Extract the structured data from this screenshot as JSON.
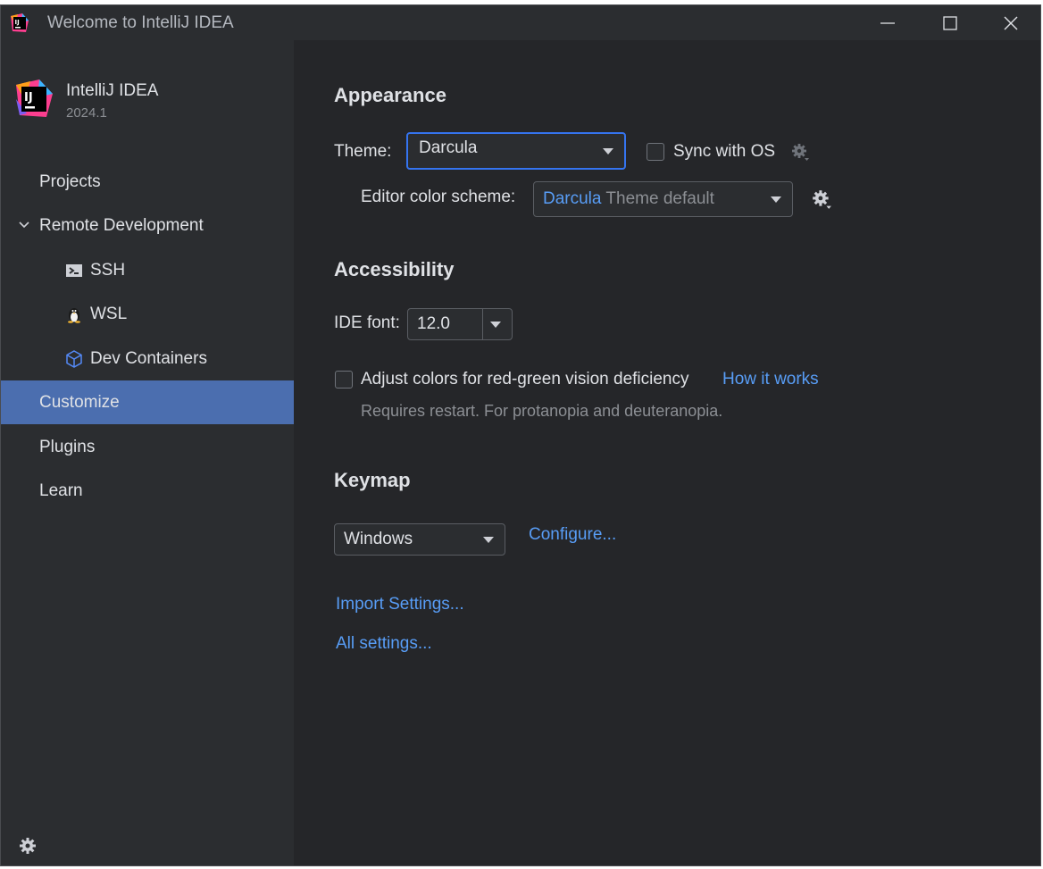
{
  "window": {
    "title": "Welcome to IntelliJ IDEA"
  },
  "brand": {
    "name": "IntelliJ IDEA",
    "version": "2024.1"
  },
  "sidebar": {
    "items": [
      {
        "label": "Projects"
      },
      {
        "label": "Remote Development"
      },
      {
        "label": "SSH"
      },
      {
        "label": "WSL"
      },
      {
        "label": "Dev Containers"
      },
      {
        "label": "Customize"
      },
      {
        "label": "Plugins"
      },
      {
        "label": "Learn"
      }
    ],
    "selected": "Customize"
  },
  "appearance": {
    "title": "Appearance",
    "theme_label": "Theme:",
    "theme_value": "Darcula",
    "sync_label": "Sync with OS",
    "editor_scheme_label": "Editor color scheme:",
    "editor_scheme_name": "Darcula",
    "editor_scheme_suffix": "Theme default"
  },
  "accessibility": {
    "title": "Accessibility",
    "ide_font_label": "IDE font:",
    "ide_font_value": "12.0",
    "adjust_colors_label": "Adjust colors for red-green vision deficiency",
    "how_it_works": "How it works",
    "hint": "Requires restart. For protanopia and deuteranopia."
  },
  "keymap": {
    "title": "Keymap",
    "value": "Windows",
    "configure": "Configure..."
  },
  "links": {
    "import_settings": "Import Settings...",
    "all_settings": "All settings..."
  },
  "colors": {
    "accent": "#3574f0",
    "link": "#589df6",
    "selection": "#4b6eaf",
    "background": "#2b2d30"
  }
}
